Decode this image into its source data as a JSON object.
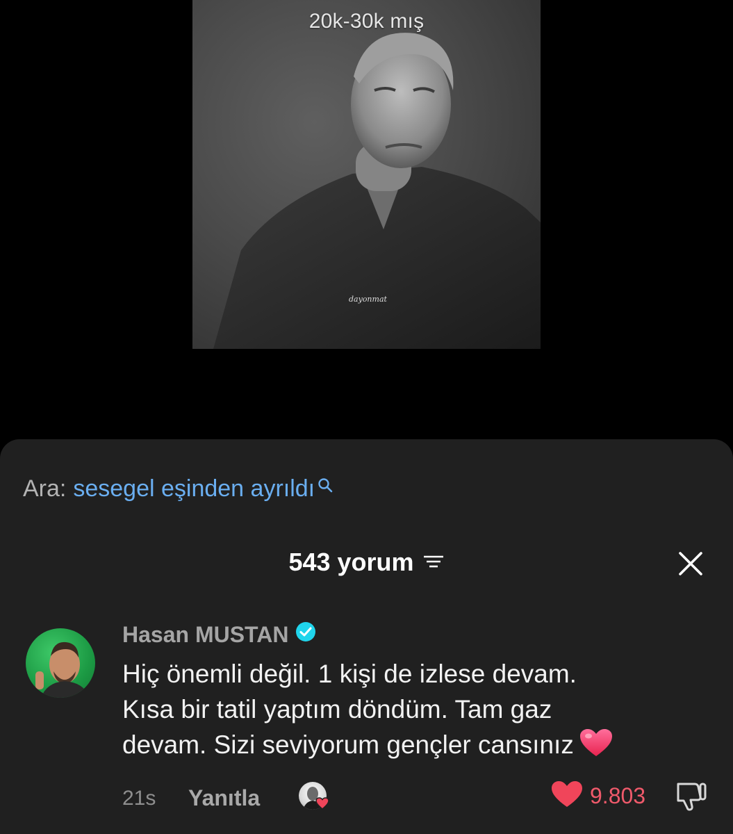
{
  "video": {
    "caption": "20k-30k mış",
    "watermark": "dayonmat"
  },
  "search_suggestion": {
    "prefix": "Ara:",
    "term": "sesegel eşinden ayrıldı"
  },
  "comments": {
    "header": "543 yorum"
  },
  "comment": {
    "author": "Hasan MUSTAN",
    "verified": true,
    "lines": [
      "Hiç önemli değil. 1 kişi de izlese devam.",
      "Kısa bir tatil yaptım döndüm. Tam gaz",
      "devam. Sizi seviyorum gençler cansınız"
    ],
    "time": "21s",
    "reply_label": "Yanıtla",
    "like_count": "9.803"
  },
  "colors": {
    "sheet_bg": "#202020",
    "link_blue": "#6aaef0",
    "like_red": "#f0455a",
    "verified_blue": "#20d5ec"
  }
}
